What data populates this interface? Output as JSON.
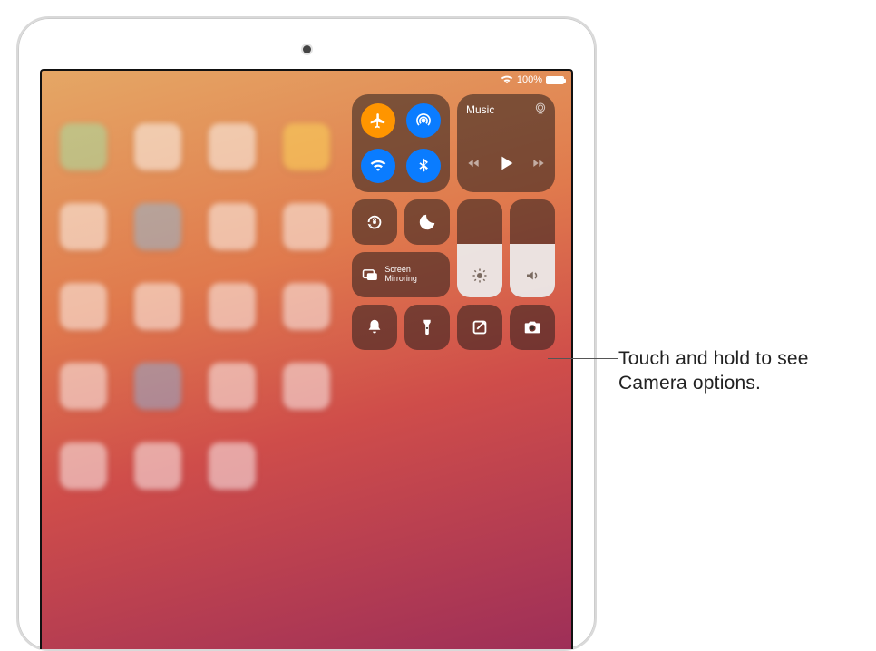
{
  "status": {
    "battery_pct": "100%"
  },
  "media": {
    "title": "Music"
  },
  "mirror": {
    "label": "Screen Mirroring"
  },
  "callout": {
    "text": "Touch and hold to see Camera options."
  },
  "icons": {
    "airplane": "airplane-icon",
    "airdrop": "airdrop-icon",
    "wifi": "wifi-icon",
    "bluetooth": "bluetooth-icon",
    "airplay": "airplay-icon",
    "rewind": "rewind-icon",
    "play": "play-icon",
    "forward": "forward-icon",
    "rotation_lock": "rotation-lock-icon",
    "dnd": "do-not-disturb-icon",
    "brightness": "brightness-icon",
    "volume": "volume-icon",
    "screen_mirror": "screen-mirroring-icon",
    "silence": "bell-icon",
    "flashlight": "flashlight-icon",
    "note": "quick-note-icon",
    "camera": "camera-icon"
  }
}
